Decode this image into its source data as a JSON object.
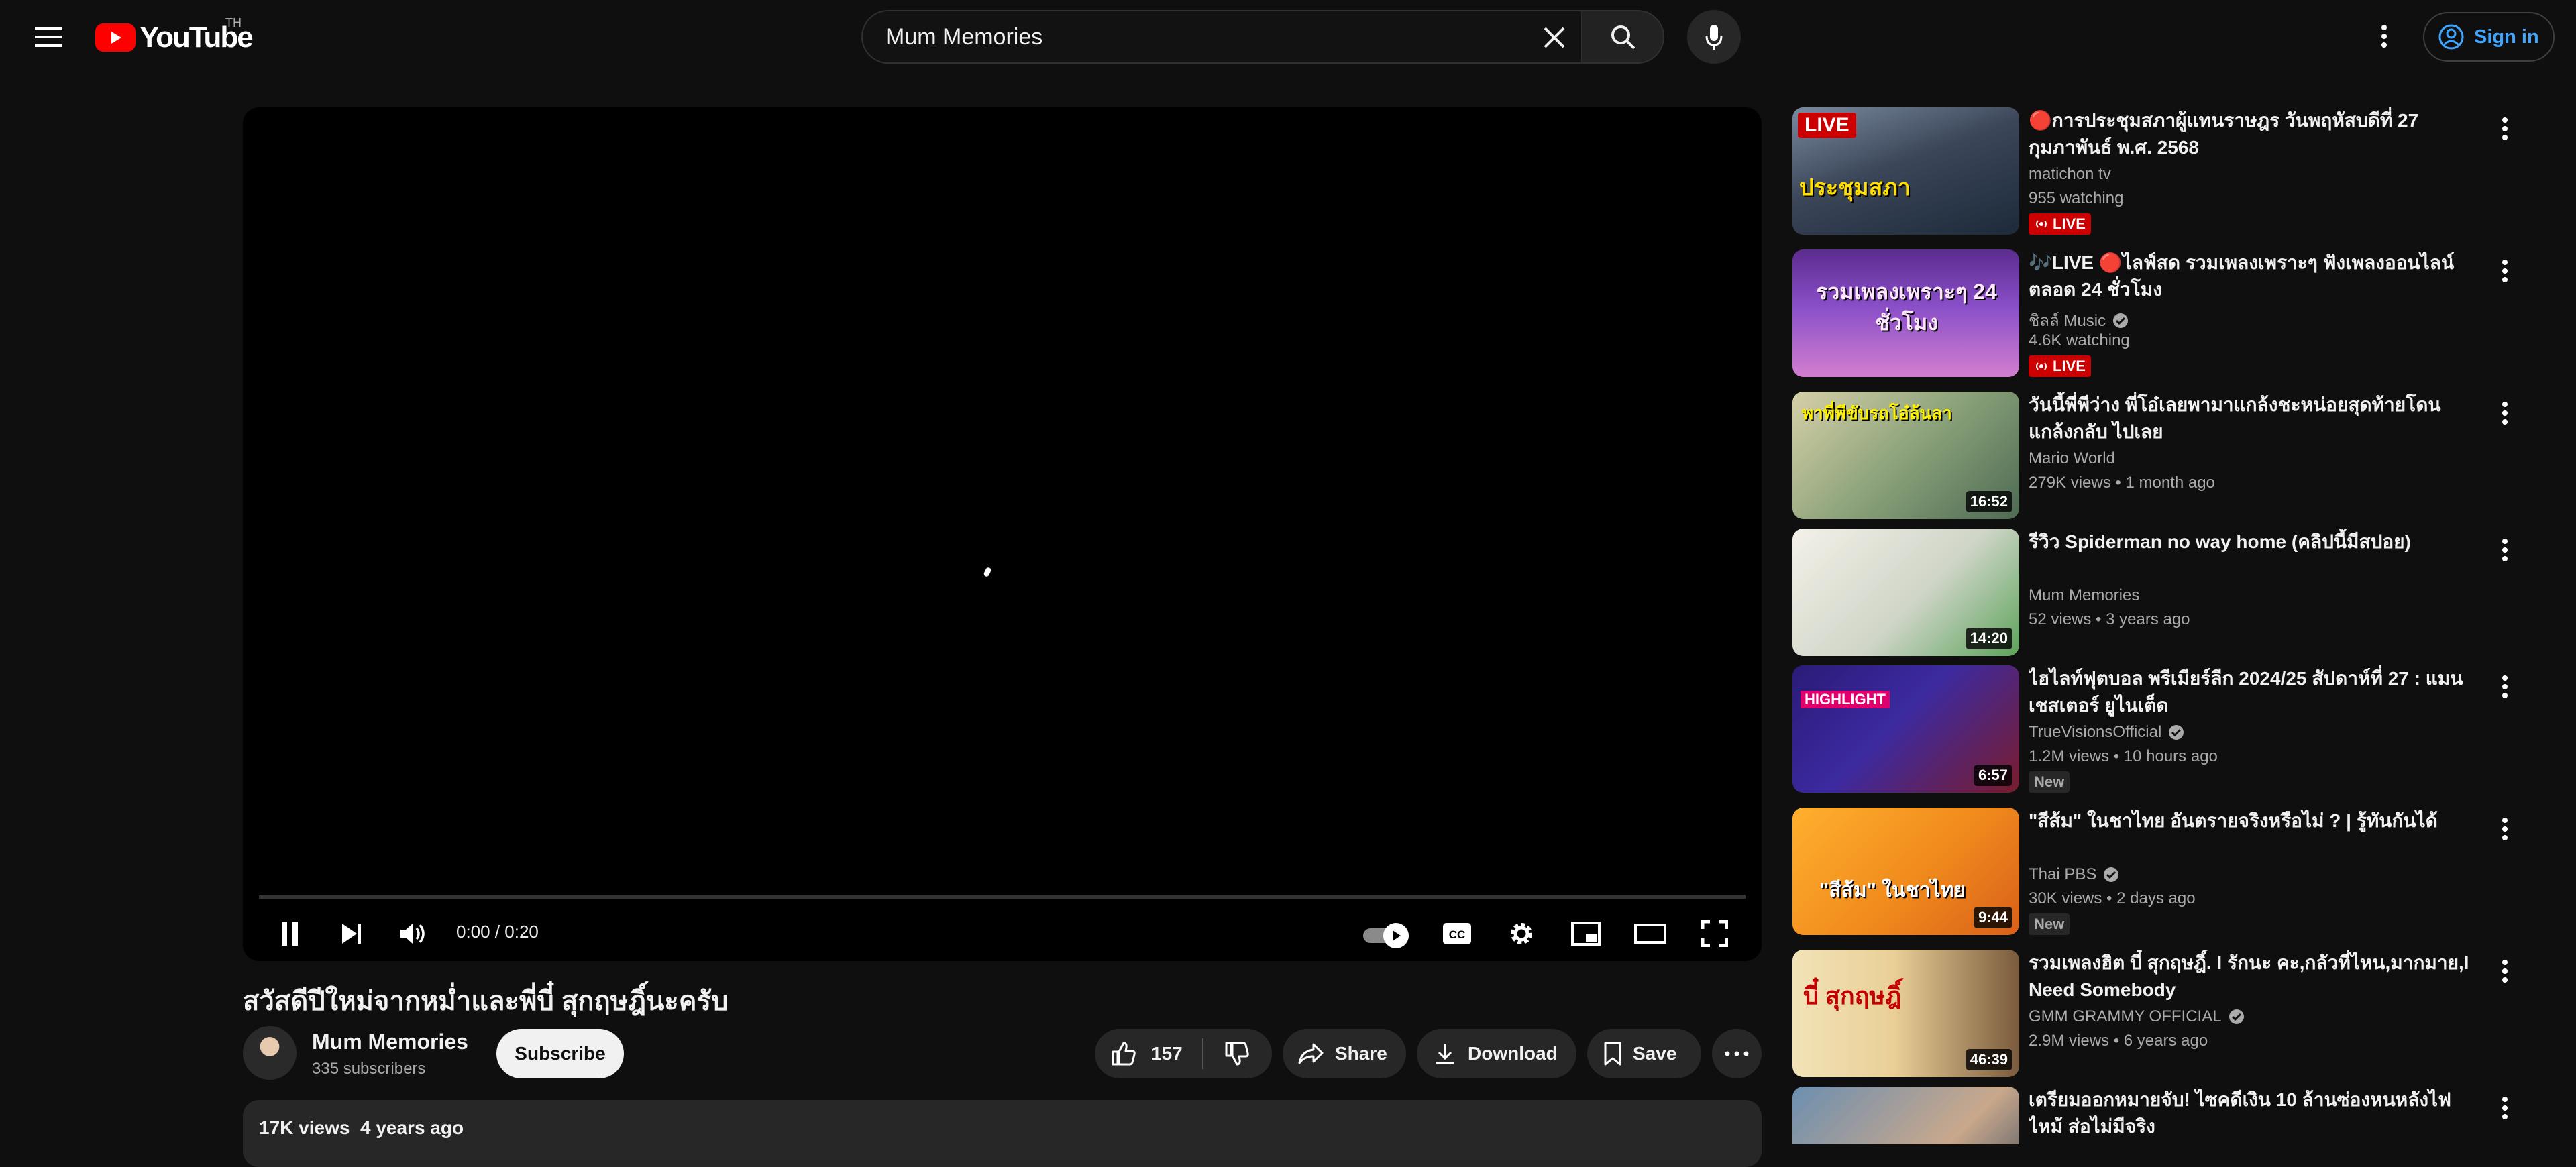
{
  "masthead": {
    "logo_text": "YouTube",
    "region": "TH",
    "search_value": "Mum Memories",
    "signin_label": "Sign in"
  },
  "player": {
    "time": "0:00 / 0:20",
    "progress": 0
  },
  "video": {
    "title": "สวัสดีปีใหม่จากหม่ำและพี่บี๋ สุกฤษฎิ์นะครับ",
    "channel": "Mum Memories",
    "subscribers": "335 subscribers",
    "subscribe_label": "Subscribe",
    "likes": "157",
    "share_label": "Share",
    "download_label": "Download",
    "save_label": "Save",
    "views": "17K views",
    "uploaded": "4 years ago"
  },
  "related": [
    {
      "title": "🔴การประชุมสภาผู้แทนราษฎร วันพฤหัสบดีที่ 27 กุมภาพันธ์ พ.ศ. 2568",
      "channel": "matichon tv",
      "verified": false,
      "meta": "955 watching",
      "badge": "LIVE",
      "duration": "",
      "thumb_text": "ประชุมสภา",
      "thumb_badge": "LIVE"
    },
    {
      "title": "🎶LIVE 🔴ไลฟ์สด รวมเพลงเพราะๆ ฟังเพลงออนไลน์ ตลอด 24 ชั่วโมง",
      "channel": "ชิลล์ Music",
      "verified": true,
      "meta": "4.6K watching",
      "badge": "LIVE",
      "duration": "",
      "thumb_text": "รวมเพลงเพราะๆ 24 ชั่วโมง",
      "thumb_badge": ""
    },
    {
      "title": "วันนี้พี่พีว่าง พี่โอ๋เลยพามาแกล้งชะหน่อยสุดท้ายโดนแกล้งกลับ ไปเลย",
      "channel": "Mario World",
      "verified": false,
      "meta": "279K views • 1 month ago",
      "badge": "",
      "duration": "16:52",
      "thumb_text": "พาพี่พีขับรถโอ๋ล้นลา",
      "thumb_badge": ""
    },
    {
      "title": "รีวิว Spiderman no way home (คลิปนี้มีสปอย)",
      "channel": "Mum Memories",
      "verified": false,
      "meta": "52 views • 3 years ago",
      "badge": "",
      "duration": "14:20",
      "thumb_text": "",
      "thumb_badge": ""
    },
    {
      "title": "ไฮไลท์ฟุตบอล พรีเมียร์ลีก 2024/25 สัปดาห์ที่ 27 : แมนเชสเตอร์ ยูไนเต็ด",
      "channel": "TrueVisionsOfficial",
      "verified": true,
      "meta": "1.2M views • 10 hours ago",
      "badge": "New",
      "duration": "6:57",
      "thumb_text": "HIGHLIGHT",
      "thumb_badge": ""
    },
    {
      "title": "\"สีส้ม\" ในชาไทย อันตรายจริงหรือไม่ ? | รู้ทันกันได้",
      "channel": "Thai PBS",
      "verified": true,
      "meta": "30K views • 2 days ago",
      "badge": "New",
      "duration": "9:44",
      "thumb_text": "\"สีส้ม\" ในชาไทย",
      "thumb_badge": ""
    },
    {
      "title": "รวมเพลงฮิต บี๋ สุกฤษฎิ์. l รักนะ คะ,กลัวที่ไหน,มากมาย,l Need Somebody",
      "channel": "GMM GRAMMY OFFICIAL",
      "verified": true,
      "meta": "2.9M views • 6 years ago",
      "badge": "",
      "duration": "46:39",
      "thumb_text": "บี๋ สุกฤษฎิ์",
      "thumb_badge": ""
    },
    {
      "title": "เตรียมออกหมายจับ! ไซคดีเงิน 10 ล้านซ่องหนหลังไฟไหม้ ส่อไม่มีจริง",
      "channel": "",
      "verified": false,
      "meta": "",
      "badge": "",
      "duration": "",
      "thumb_text": "",
      "thumb_badge": ""
    }
  ],
  "colors": {
    "background": "#0f0f0f",
    "accent_red": "#ff0000",
    "link_blue": "#3ea6ff",
    "live_red": "#cc0000"
  }
}
